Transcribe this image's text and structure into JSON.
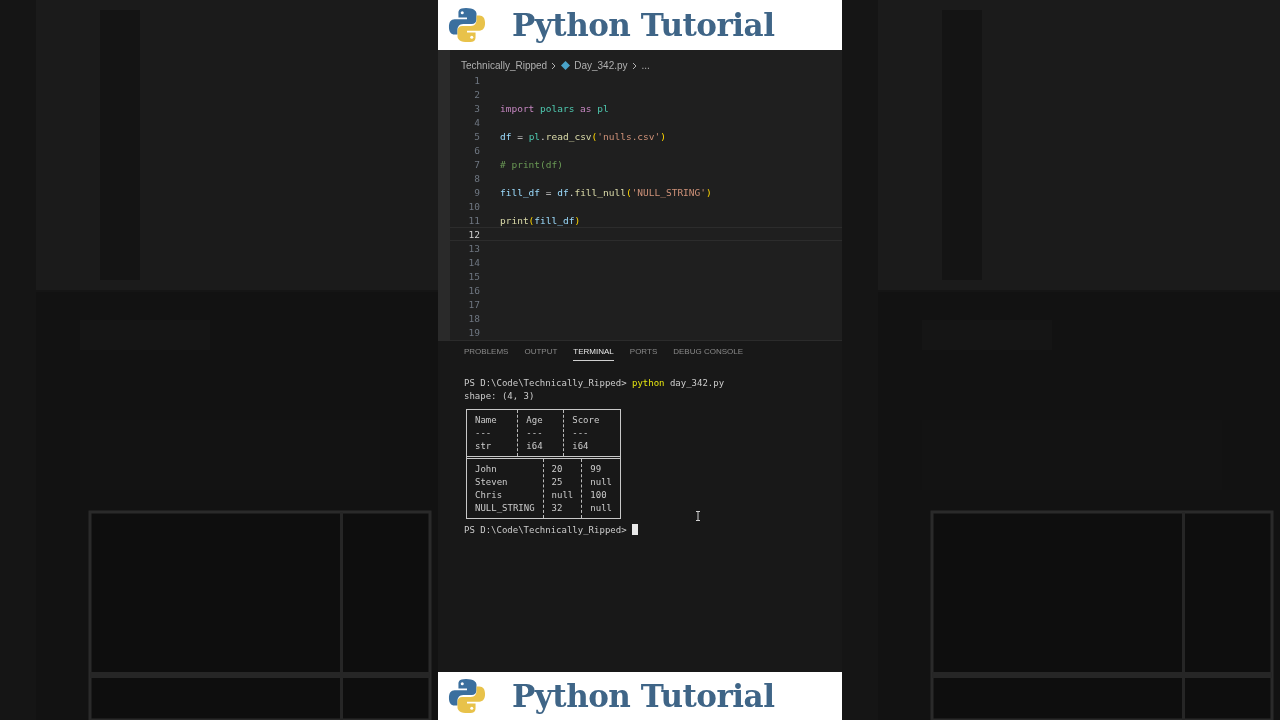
{
  "banner_top": {
    "title": "Python Tutorial"
  },
  "editor": {
    "breadcrumb": [
      "Technically_Ripped",
      "Day_342.py",
      "..."
    ],
    "lines": [
      {
        "number": "1",
        "current": false
      },
      {
        "number": "2",
        "current": false
      },
      {
        "number": "3",
        "current": false,
        "tokens": [
          {
            "text": "import",
            "kind": "keyword"
          },
          {
            "text": " polars",
            "kind": "module"
          },
          {
            "text": " as",
            "kind": "keyword"
          },
          {
            "text": " pl",
            "kind": "module"
          }
        ]
      },
      {
        "number": "4",
        "current": false
      },
      {
        "number": "5",
        "current": false,
        "tokens": [
          {
            "text": "df",
            "kind": "variable"
          },
          {
            "text": " = "
          },
          {
            "text": "pl",
            "kind": "module"
          },
          {
            "text": "."
          },
          {
            "text": "read_csv",
            "kind": "function"
          },
          {
            "text": "(",
            "kind": "bracket"
          },
          {
            "text": "'nulls.csv'",
            "kind": "string"
          },
          {
            "text": ")",
            "kind": "bracket"
          }
        ]
      },
      {
        "number": "6",
        "current": false
      },
      {
        "number": "7",
        "current": false,
        "tokens": [
          {
            "text": "# print(df)",
            "kind": "comment"
          }
        ]
      },
      {
        "number": "8",
        "current": false
      },
      {
        "number": "9",
        "current": false,
        "tokens": [
          {
            "text": "fill_df",
            "kind": "variable"
          },
          {
            "text": " = "
          },
          {
            "text": "df",
            "kind": "variable"
          },
          {
            "text": "."
          },
          {
            "text": "fill_null",
            "kind": "function"
          },
          {
            "text": "(",
            "kind": "bracket"
          },
          {
            "text": "'NULL_STRING'",
            "kind": "string"
          },
          {
            "text": ")",
            "kind": "bracket"
          }
        ]
      },
      {
        "number": "10",
        "current": false
      },
      {
        "number": "11",
        "current": false,
        "tokens": [
          {
            "text": "print",
            "kind": "function"
          },
          {
            "text": "(",
            "kind": "bracket"
          },
          {
            "text": "fill_df",
            "kind": "variable"
          },
          {
            "text": ")",
            "kind": "bracket"
          }
        ]
      },
      {
        "number": "12",
        "current": true
      },
      {
        "number": "13",
        "current": false
      },
      {
        "number": "14",
        "current": false
      },
      {
        "number": "15",
        "current": false
      },
      {
        "number": "16",
        "current": false
      },
      {
        "number": "17",
        "current": false
      },
      {
        "number": "18",
        "current": false
      },
      {
        "number": "19",
        "current": false
      }
    ]
  },
  "panel": {
    "tabs": [
      {
        "label": "PROBLEMS",
        "selected": false
      },
      {
        "label": "OUTPUT",
        "selected": false
      },
      {
        "label": "TERMINAL",
        "selected": true
      },
      {
        "label": "PORTS",
        "selected": false
      },
      {
        "label": "DEBUG CONSOLE",
        "selected": false
      }
    ],
    "terminal": {
      "command_line": [
        {
          "text": "PS D:\\Code\\Technically_Ripped> "
        },
        {
          "text": "python",
          "kind": "command"
        },
        {
          "text": " day_342.py"
        }
      ],
      "shape": "shape: (4, 3)",
      "table": {
        "columns": [
          {
            "name": "Name",
            "rule": "---",
            "dtype": "str"
          },
          {
            "name": "Age",
            "rule": "---",
            "dtype": "i64"
          },
          {
            "name": "Score",
            "rule": "---",
            "dtype": "i64"
          }
        ],
        "rows": [
          [
            "John",
            "20",
            "99"
          ],
          [
            "Steven",
            "25",
            "null"
          ],
          [
            "Chris",
            "null",
            "100"
          ],
          [
            "NULL_STRING",
            "32",
            "null"
          ]
        ]
      },
      "prompt": "PS D:\\Code\\Technically_Ripped>"
    }
  },
  "banner_bottom": {
    "title": "Python Tutorial"
  }
}
